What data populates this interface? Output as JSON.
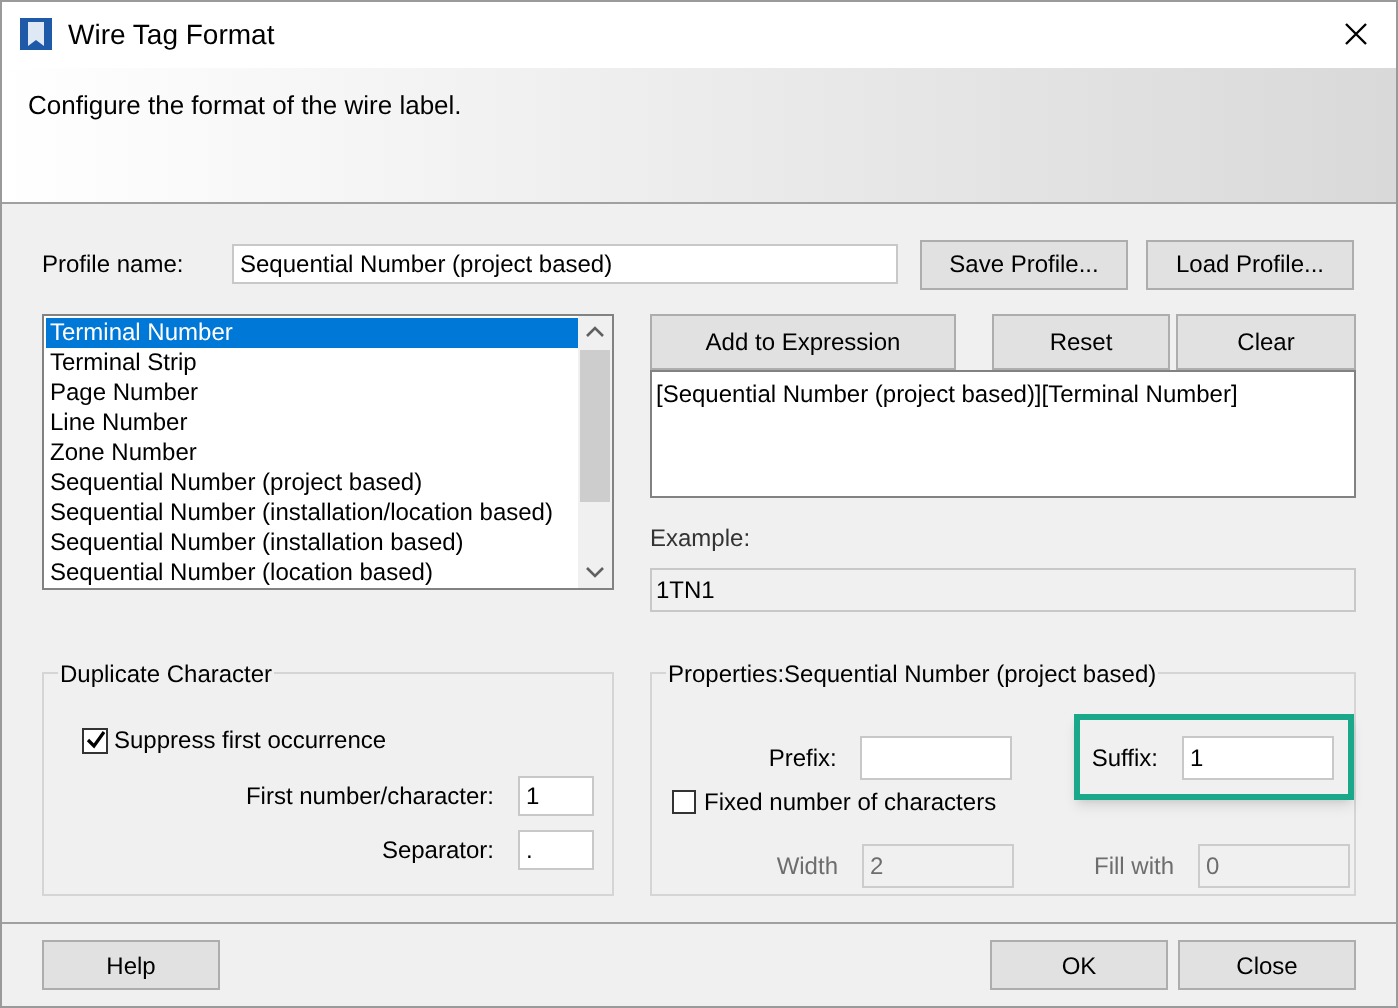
{
  "window": {
    "title": "Wire Tag Format"
  },
  "header": {
    "description": "Configure the format of the wire label."
  },
  "profile": {
    "label": "Profile name:",
    "value": "Sequential Number (project based)",
    "buttons": [
      "Save Profile...",
      "Load Profile..."
    ]
  },
  "placeholder_list": {
    "items": [
      {
        "label": "Terminal Number",
        "selected": true
      },
      {
        "label": "Terminal Strip",
        "selected": false
      },
      {
        "label": "Page Number",
        "selected": false
      },
      {
        "label": "Line Number",
        "selected": false
      },
      {
        "label": "Zone Number",
        "selected": false
      },
      {
        "label": "Sequential Number (project based)",
        "selected": false
      },
      {
        "label": "Sequential Number (installation/location based)",
        "selected": false
      },
      {
        "label": "Sequential Number (installation based)",
        "selected": false
      },
      {
        "label": "Sequential Number (location based)",
        "selected": false
      }
    ]
  },
  "expression_buttons": [
    "Add to Expression",
    "Reset",
    "Clear"
  ],
  "expression": {
    "value": "[Sequential Number (project based)][Terminal Number]"
  },
  "example": {
    "label": "Example:",
    "value": "1TN1"
  },
  "duplicate_character": {
    "title": "Duplicate Character",
    "suppress": {
      "label": "Suppress first occurrence",
      "checked": true
    },
    "first_number": {
      "label": "First number/character:",
      "value": "1"
    },
    "separator": {
      "label": "Separator:",
      "value": "."
    }
  },
  "properties": {
    "title": "Properties:Sequential Number (project based)",
    "prefix": {
      "label": "Prefix:"
    },
    "suffix": {
      "label": "Suffix:",
      "value": "1",
      "highlighted": true
    },
    "fixed": {
      "label": "Fixed number of characters",
      "checked": false
    },
    "width": {
      "label": "Width",
      "value": "2",
      "disabled": true
    },
    "fill_with": {
      "label": "Fill with",
      "value": "0",
      "disabled": true
    }
  },
  "footer": {
    "help_button": "Help",
    "buttons": [
      "OK",
      "Close"
    ]
  }
}
